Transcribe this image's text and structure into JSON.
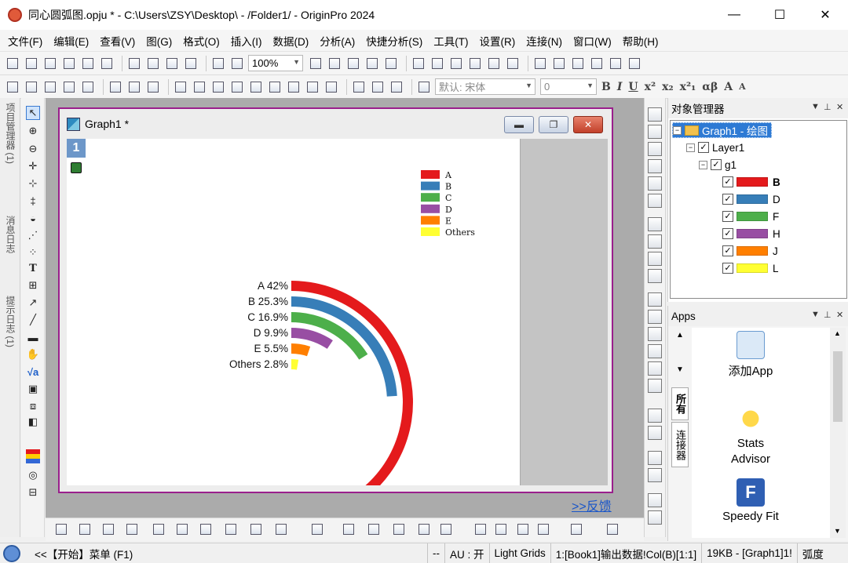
{
  "window": {
    "title": "同心圆弧图.opju * - C:\\Users\\ZSY\\Desktop\\ - /Folder1/ - OriginPro 2024",
    "minimize": "—",
    "maximize": "☐",
    "close": "✕"
  },
  "menu": [
    "文件(F)",
    "编辑(E)",
    "查看(V)",
    "图(G)",
    "格式(O)",
    "插入(I)",
    "数据(D)",
    "分析(A)",
    "快捷分析(S)",
    "工具(T)",
    "设置(R)",
    "连接(N)",
    "窗口(W)",
    "帮助(H)"
  ],
  "toolbar": {
    "zoom": "100%",
    "font_name": "默认: 宋体",
    "font_size": "0"
  },
  "side_tabs": [
    "项目管理器 (1)",
    "消息日志",
    "提示日志 (1)"
  ],
  "graph_window": {
    "title": "Graph1 *",
    "layer_label": "1"
  },
  "feedback_link": ">>反馈",
  "object_manager": {
    "title": "对象管理器",
    "root": "Graph1 - 绘图",
    "layer": "Layer1",
    "group": "g1",
    "plots": [
      {
        "label": "B",
        "color": "#e41a1c"
      },
      {
        "label": "D",
        "color": "#377eb8"
      },
      {
        "label": "F",
        "color": "#4daf4a"
      },
      {
        "label": "H",
        "color": "#984ea3"
      },
      {
        "label": "J",
        "color": "#ff7f00"
      },
      {
        "label": "L",
        "color": "#ffff33"
      }
    ]
  },
  "apps": {
    "title": "Apps",
    "tabs": [
      "所有",
      "连接器"
    ],
    "items": [
      "添加App",
      "Stats Advisor",
      "Speedy Fit"
    ]
  },
  "status": {
    "left": "<<【开始】菜单 (F1)",
    "dash": "--",
    "au": "AU : 开",
    "grids": "Light Grids",
    "cell": "1:[Book1]输出数据!Col(B)[1:1]",
    "size": "19KB - [Graph1]1!",
    "unit": "弧度"
  },
  "chart_data": {
    "type": "pie",
    "variant": "concentric-arc",
    "categories": [
      "A",
      "B",
      "C",
      "D",
      "E",
      "Others"
    ],
    "values": [
      42,
      25.3,
      16.9,
      9.9,
      5.5,
      2.8
    ],
    "unit": "%",
    "colors": [
      "#e41a1c",
      "#377eb8",
      "#4daf4a",
      "#984ea3",
      "#ff7f00",
      "#ffff33"
    ],
    "arc_labels": [
      "A 42%",
      "B 25.3%",
      "C 16.9%",
      "D 9.9%",
      "E 5.5%",
      "Others 2.8%"
    ],
    "legend": [
      "A",
      "B",
      "C",
      "D",
      "E",
      "Others"
    ],
    "legend_position": "top-right"
  }
}
